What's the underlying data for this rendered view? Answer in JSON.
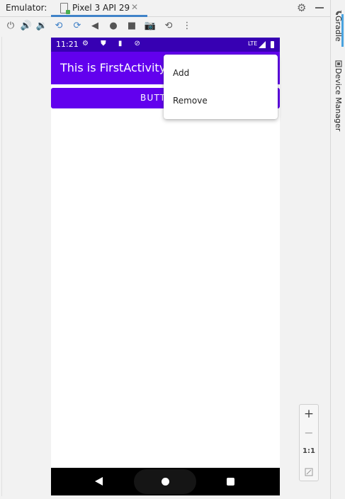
{
  "tabbar": {
    "label": "Emulator:",
    "tab_title": "Pixel 3 API 29",
    "close_glyph": "✕",
    "settings_icon": "gear-icon",
    "minimize_icon": "minimize-icon"
  },
  "toolbar": {
    "buttons": [
      {
        "name": "power-button",
        "glyph": "⏻",
        "tooltip": "Power"
      },
      {
        "name": "volume-up-button",
        "glyph": "🔊",
        "tooltip": "Volume Up"
      },
      {
        "name": "volume-down-button",
        "glyph": "🔉",
        "tooltip": "Volume Down"
      },
      {
        "name": "rotate-left-button",
        "glyph": "⟲",
        "tooltip": "Rotate Left"
      },
      {
        "name": "rotate-right-button",
        "glyph": "⟳",
        "tooltip": "Rotate Right"
      },
      {
        "name": "back-button",
        "glyph": "◀",
        "tooltip": "Back"
      },
      {
        "name": "home-button",
        "glyph": "●",
        "tooltip": "Home"
      },
      {
        "name": "overview-button",
        "glyph": "■",
        "tooltip": "Overview"
      },
      {
        "name": "screenshot-button",
        "glyph": "📷",
        "tooltip": "Take Screenshot"
      },
      {
        "name": "snapshot-button",
        "glyph": "⟲",
        "tooltip": "Snapshots"
      },
      {
        "name": "more-button",
        "glyph": "⋮",
        "tooltip": "Extended Controls"
      }
    ]
  },
  "right_panel": {
    "gradle_label": "Gradle",
    "device_manager_label": "Device Manager"
  },
  "phone": {
    "status_bar": {
      "time": "11:21",
      "icons": "⚙ ⛊ ▮ ⊘",
      "network": "LTE",
      "color": "#3700b3"
    },
    "app_title": "This is FirstActivity",
    "appbar_color": "#6200ee",
    "button_label": "BUTTON 1",
    "popup_menu": [
      {
        "label": "Add"
      },
      {
        "label": "Remove"
      }
    ]
  },
  "zoom": {
    "zoom_in": "+",
    "zoom_out": "−",
    "actual_size": "1:1",
    "fit_icon": "fit-screen-icon"
  }
}
